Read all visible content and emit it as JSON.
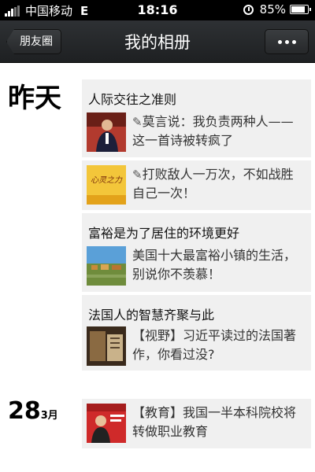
{
  "status_bar": {
    "carrier": "中国移动",
    "network": "E",
    "time": "18:16",
    "battery": "85%",
    "battery_level": 0.85
  },
  "nav": {
    "back_label": "朋友圈",
    "title": "我的相册"
  },
  "groups": [
    {
      "date": "昨天",
      "posts": [
        {
          "title": "人际交往之准则",
          "text": "莫言说：我负责两种人——这一首诗被转疯了",
          "pencil": true
        },
        {
          "title": "",
          "text": "打败敌人一万次，不如战胜自己一次！",
          "pencil": true,
          "thumb_caption": "心灵之力"
        },
        {
          "title": "富裕是为了居住的环境更好",
          "text": "美国十大最富裕小镇的生活，别说你不羡慕！",
          "pencil": false
        },
        {
          "title": "法国人的智慧齐聚与此",
          "text": "【视野】习近平读过的法国著作，你看过没?",
          "pencil": false
        }
      ]
    },
    {
      "date_day": "28",
      "date_month": "3月",
      "posts": [
        {
          "title": "",
          "text": "【教育】我国一半本科院校将转做职业教育",
          "pencil": false
        }
      ]
    }
  ],
  "colors": {
    "nav_bg": "#26282a",
    "card_bg": "#f0f0f0",
    "status_bg": "#000000"
  }
}
